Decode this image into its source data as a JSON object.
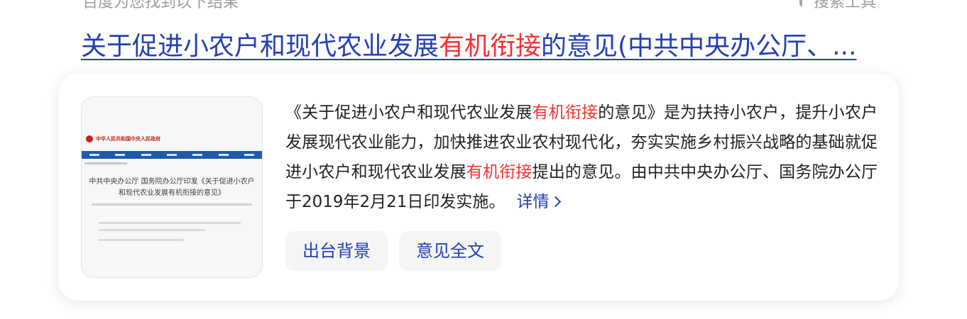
{
  "header": {
    "result_note": "百度为您找到以下结果",
    "search_tools_label": "搜索工具",
    "search_tools_icon": "funnel-icon"
  },
  "result": {
    "title_part1": "关于促进小农户和现代农业发展",
    "title_highlight": "有机衔接",
    "title_part2": "的意见(中共中央办公厅、...",
    "thumbnail": {
      "site_name": "中华人民共和国中央人民政府",
      "headline": "中共中央办公厅 国务院办公厅印发《关于促进小农户和现代农业发展有机衔接的意见》"
    },
    "description": {
      "part1": "《关于促进小农户和现代农业发展",
      "highlight1": "有机衔接",
      "part2": "的意见》是为扶持小农户，提升小农户发展现代农业能力，加快推进农业农村现代化，夯实实施乡村振兴战略的基础就促进小农户和现代农业发展",
      "highlight2": "有机衔接",
      "part3": "提出的意见。由中共中央办公厅、国务院办公厅于2019年2月21日印发实施。",
      "more_label": "详情"
    },
    "chips": [
      {
        "label": "出台背景"
      },
      {
        "label": "意见全文"
      }
    ]
  },
  "colors": {
    "link": "#2440b3",
    "highlight": "#f73131",
    "text": "#222222",
    "muted": "#9a9ba0",
    "chip_bg": "#f5f5f6"
  }
}
